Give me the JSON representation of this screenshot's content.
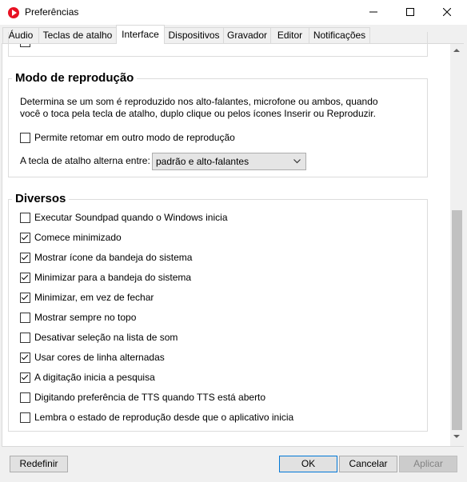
{
  "window": {
    "title": "Preferências"
  },
  "tabs": [
    {
      "label": "Áudio"
    },
    {
      "label": "Teclas de atalho"
    },
    {
      "label": "Interface"
    },
    {
      "label": "Dispositivos"
    },
    {
      "label": "Gravador"
    },
    {
      "label": "Editor"
    },
    {
      "label": "Notificações"
    }
  ],
  "playback_mode": {
    "title": "Modo de reprodução",
    "description_line1": "Determina se um som é reproduzido nos alto-falantes, microfone ou ambos, quando",
    "description_line2": "você o toca pela tecla de atalho, duplo clique ou pelos ícones Inserir ou Reproduzir.",
    "resume_checkbox": {
      "label": "Permite retomar em outro modo de reprodução",
      "checked": false
    },
    "hotkey_label": "A tecla de atalho alterna entre:",
    "hotkey_value": "padrão e alto-falantes"
  },
  "misc": {
    "title": "Diversos",
    "options": [
      {
        "label": "Executar Soundpad quando o Windows inicia",
        "checked": false
      },
      {
        "label": "Comece minimizado",
        "checked": true
      },
      {
        "label": "Mostrar ícone da bandeja do sistema",
        "checked": true
      },
      {
        "label": "Minimizar para a bandeja do sistema",
        "checked": true
      },
      {
        "label": "Minimizar, em vez de fechar",
        "checked": true
      },
      {
        "label": "Mostrar sempre no topo",
        "checked": false
      },
      {
        "label": "Desativar seleção na lista de som",
        "checked": false
      },
      {
        "label": "Usar cores de linha alternadas",
        "checked": true
      },
      {
        "label": "A digitação inicia a pesquisa",
        "checked": true
      },
      {
        "label": "Digitando preferência de TTS quando TTS está aberto",
        "checked": false
      },
      {
        "label": "Lembra o estado de reprodução desde que o aplicativo inicia",
        "checked": false
      }
    ]
  },
  "footer": {
    "reset_label": "Redefinir",
    "ok_label": "OK",
    "cancel_label": "Cancelar",
    "apply_label": "Aplicar"
  }
}
